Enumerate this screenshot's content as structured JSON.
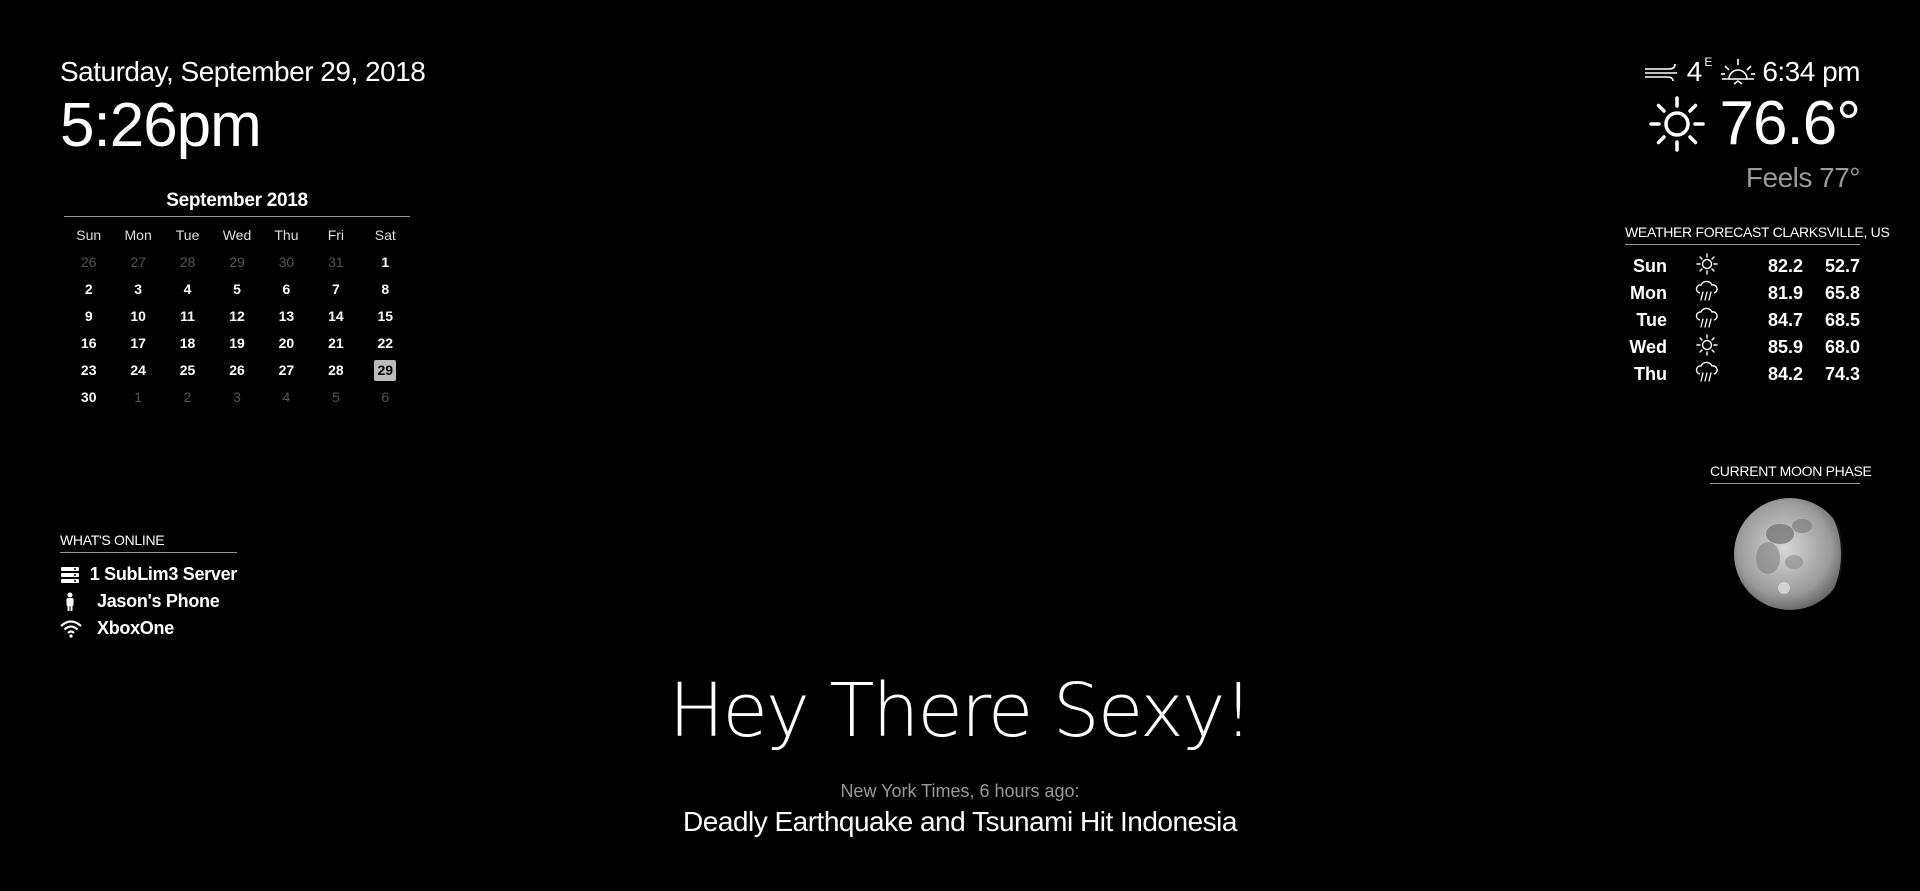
{
  "clock": {
    "date": "Saturday, September 29, 2018",
    "time": "5:26pm"
  },
  "calendar": {
    "title": "September 2018",
    "weekdays": [
      "Sun",
      "Mon",
      "Tue",
      "Wed",
      "Thu",
      "Fri",
      "Sat"
    ],
    "weeks": [
      [
        {
          "d": "26",
          "m": true
        },
        {
          "d": "27",
          "m": true
        },
        {
          "d": "28",
          "m": true
        },
        {
          "d": "29",
          "m": true
        },
        {
          "d": "30",
          "m": true
        },
        {
          "d": "31",
          "m": true
        },
        {
          "d": "1"
        }
      ],
      [
        {
          "d": "2"
        },
        {
          "d": "3"
        },
        {
          "d": "4"
        },
        {
          "d": "5"
        },
        {
          "d": "6"
        },
        {
          "d": "7"
        },
        {
          "d": "8"
        }
      ],
      [
        {
          "d": "9"
        },
        {
          "d": "10"
        },
        {
          "d": "11"
        },
        {
          "d": "12"
        },
        {
          "d": "13"
        },
        {
          "d": "14"
        },
        {
          "d": "15"
        }
      ],
      [
        {
          "d": "16"
        },
        {
          "d": "17"
        },
        {
          "d": "18"
        },
        {
          "d": "19"
        },
        {
          "d": "20"
        },
        {
          "d": "21"
        },
        {
          "d": "22"
        }
      ],
      [
        {
          "d": "23"
        },
        {
          "d": "24"
        },
        {
          "d": "25"
        },
        {
          "d": "26"
        },
        {
          "d": "27"
        },
        {
          "d": "28"
        },
        {
          "d": "29",
          "today": true
        }
      ],
      [
        {
          "d": "30"
        },
        {
          "d": "1",
          "m": true
        },
        {
          "d": "2",
          "m": true
        },
        {
          "d": "3",
          "m": true
        },
        {
          "d": "4",
          "m": true
        },
        {
          "d": "5",
          "m": true
        },
        {
          "d": "6",
          "m": true
        }
      ]
    ]
  },
  "online": {
    "header": "WHAT'S ONLINE",
    "items": [
      {
        "icon": "server-icon",
        "label": "1 SubLim3 Server"
      },
      {
        "icon": "person-icon",
        "label": "Jason's Phone"
      },
      {
        "icon": "wifi-icon",
        "label": "XboxOne"
      }
    ]
  },
  "weather": {
    "wind_speed": "4",
    "wind_direction": "E",
    "sunset_time": "6:34 pm",
    "temperature": "76.6°",
    "feels_like": "Feels 77°",
    "icons": {
      "wind": "wind-icon",
      "sunset": "sunset-icon",
      "current": "sun-icon"
    }
  },
  "forecast": {
    "header": "WEATHER FORECAST CLARKSVILLE, US",
    "days": [
      {
        "day": "Sun",
        "icon": "sun-icon",
        "max": "82.2",
        "min": "52.7"
      },
      {
        "day": "Mon",
        "icon": "rain-icon",
        "max": "81.9",
        "min": "65.8"
      },
      {
        "day": "Tue",
        "icon": "rain-icon",
        "max": "84.7",
        "min": "68.5"
      },
      {
        "day": "Wed",
        "icon": "sun-icon",
        "max": "85.9",
        "min": "68.0"
      },
      {
        "day": "Thu",
        "icon": "rain-icon",
        "max": "84.2",
        "min": "74.3"
      }
    ]
  },
  "moon": {
    "header": "CURRENT MOON PHASE",
    "icon": "moon-icon"
  },
  "compliment": "Hey There Sexy!",
  "news": {
    "source": "New York Times, 6 hours ago:",
    "headline": "Deadly Earthquake and Tsunami Hit Indonesia"
  }
}
